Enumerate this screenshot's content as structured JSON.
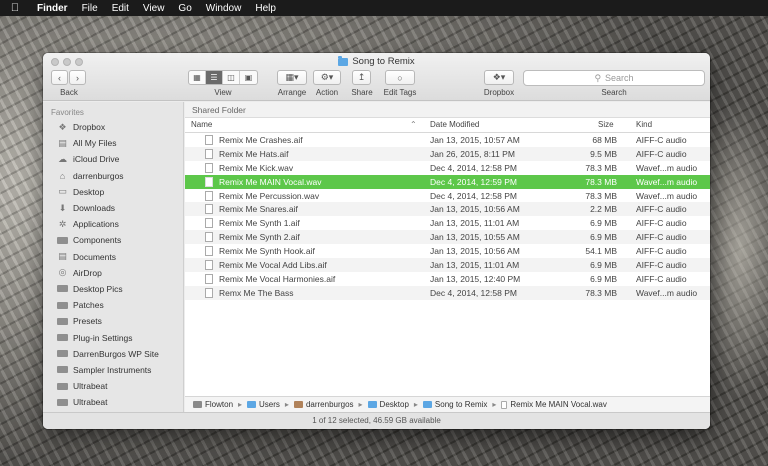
{
  "menubar": {
    "apple": "",
    "items": [
      "Finder",
      "File",
      "Edit",
      "View",
      "Go",
      "Window",
      "Help"
    ]
  },
  "window": {
    "title": "Song to Remix",
    "toolbar": {
      "back_label": "Back",
      "view_label": "View",
      "arrange_label": "Arrange",
      "action_label": "Action",
      "share_label": "Share",
      "edit_tags_label": "Edit Tags",
      "dropbox_label": "Dropbox",
      "search_label": "Search",
      "search_placeholder": "Search"
    },
    "sidebar": {
      "heading": "Favorites",
      "items": [
        {
          "label": "Dropbox",
          "icon": "dropbox-icon"
        },
        {
          "label": "All My Files",
          "icon": "all-files-icon"
        },
        {
          "label": "iCloud Drive",
          "icon": "cloud-icon"
        },
        {
          "label": "darrenburgos",
          "icon": "home-icon"
        },
        {
          "label": "Desktop",
          "icon": "desktop-icon"
        },
        {
          "label": "Downloads",
          "icon": "downloads-icon"
        },
        {
          "label": "Applications",
          "icon": "applications-icon"
        },
        {
          "label": "Components",
          "icon": "folder-icon"
        },
        {
          "label": "Documents",
          "icon": "documents-icon"
        },
        {
          "label": "AirDrop",
          "icon": "airdrop-icon"
        },
        {
          "label": "Desktop Pics",
          "icon": "folder-icon"
        },
        {
          "label": "Patches",
          "icon": "folder-icon"
        },
        {
          "label": "Presets",
          "icon": "folder-icon"
        },
        {
          "label": "Plug-in Settings",
          "icon": "folder-icon"
        },
        {
          "label": "DarrenBurgos WP Site",
          "icon": "folder-icon"
        },
        {
          "label": "Sampler Instruments",
          "icon": "folder-icon"
        },
        {
          "label": "Ultrabeat",
          "icon": "folder-icon"
        },
        {
          "label": "Ultrabeat",
          "icon": "folder-icon"
        }
      ]
    },
    "content": {
      "section_header": "Shared Folder",
      "columns": {
        "name": "Name",
        "date": "Date Modified",
        "size": "Size",
        "kind": "Kind"
      },
      "files": [
        {
          "name": "Remix Me Crashes.aif",
          "date": "Jan 13, 2015, 10:57 AM",
          "size": "68 MB",
          "kind": "AIFF-C audio"
        },
        {
          "name": "Remix Me Hats.aif",
          "date": "Jan 26, 2015, 8:11 PM",
          "size": "9.5 MB",
          "kind": "AIFF-C audio"
        },
        {
          "name": "Remix Me Kick.wav",
          "date": "Dec 4, 2014, 12:58 PM",
          "size": "78.3 MB",
          "kind": "Wavef...m audio"
        },
        {
          "name": "Remix Me MAIN Vocal.wav",
          "date": "Dec 4, 2014, 12:59 PM",
          "size": "78.3 MB",
          "kind": "Wavef...m audio"
        },
        {
          "name": "Remix Me Percussion.wav",
          "date": "Dec 4, 2014, 12:58 PM",
          "size": "78.3 MB",
          "kind": "Wavef...m audio"
        },
        {
          "name": "Remix Me Snares.aif",
          "date": "Jan 13, 2015, 10:56 AM",
          "size": "2.2 MB",
          "kind": "AIFF-C audio"
        },
        {
          "name": "Remix Me Synth 1.aif",
          "date": "Jan 13, 2015, 11:01 AM",
          "size": "6.9 MB",
          "kind": "AIFF-C audio"
        },
        {
          "name": "Remix Me Synth 2.aif",
          "date": "Jan 13, 2015, 10:55 AM",
          "size": "6.9 MB",
          "kind": "AIFF-C audio"
        },
        {
          "name": "Remix Me Synth Hook.aif",
          "date": "Jan 13, 2015, 10:56 AM",
          "size": "54.1 MB",
          "kind": "AIFF-C audio"
        },
        {
          "name": "Remix Me Vocal Add Libs.aif",
          "date": "Jan 13, 2015, 11:01 AM",
          "size": "6.9 MB",
          "kind": "AIFF-C audio"
        },
        {
          "name": "Remix Me Vocal Harmonies.aif",
          "date": "Jan 13, 2015, 12:40 PM",
          "size": "6.9 MB",
          "kind": "AIFF-C audio"
        },
        {
          "name": "Remx Me The Bass",
          "date": "Dec 4, 2014, 12:58 PM",
          "size": "78.3 MB",
          "kind": "Wavef...m audio"
        }
      ],
      "selected_index": 3
    },
    "pathbar": {
      "segments": [
        "Flowton",
        "Users",
        "darrenburgos",
        "Desktop",
        "Song to Remix",
        "Remix Me MAIN Vocal.wav"
      ],
      "separator": "▸"
    },
    "status": "1 of 12 selected, 46.59 GB available",
    "colors": {
      "selection": "#5dc74a",
      "folder": "#5ca7e4"
    }
  }
}
